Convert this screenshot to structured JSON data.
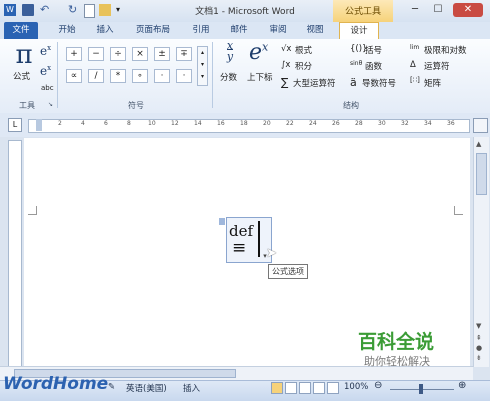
{
  "window": {
    "title": "文档1 - Microsoft Word",
    "context_tab_group": "公式工具",
    "minimize": "─",
    "maximize": "☐",
    "close": "✕"
  },
  "quick_access": {
    "icons": [
      "word-logo-icon",
      "save-icon",
      "undo-icon",
      "redo-icon",
      "new-document-icon",
      "open-folder-icon",
      "customize-icon"
    ]
  },
  "tabs": [
    "文件",
    "开始",
    "插入",
    "页面布局",
    "引用",
    "邮件",
    "审阅",
    "视图",
    "设计"
  ],
  "ribbon": {
    "tools": {
      "equation_label": "公式",
      "group_label": "工具"
    },
    "symbols": {
      "row1": [
        "+",
        "−",
        "÷",
        "×",
        "±",
        "∓"
      ],
      "row2": [
        "∝",
        "/",
        "*",
        "∘",
        "·",
        "⋅"
      ],
      "group_label": "符号"
    },
    "structures": {
      "fraction": "分数",
      "script": "上下标",
      "radical": "根式",
      "integral": "积分",
      "large_operator": "大型运算符",
      "bracket": "括号",
      "function": "函数",
      "accent": "导数符号",
      "limit_log": "极限和对数",
      "operator": "运算符",
      "matrix": "矩阵",
      "group_label": "结构"
    }
  },
  "document": {
    "equation_text": "def",
    "equation_symbol": "≡",
    "tooltip": "公式选项"
  },
  "status_bar": {
    "language": "英语(美国)",
    "insert_mode": "插入",
    "zoom": "100%"
  },
  "watermark": {
    "brand": "百科全说",
    "slogan": "助你轻松解决",
    "site": "WordHome"
  },
  "colors": {
    "file_tab": "#2a63b3",
    "context_tab": "#f6d27a",
    "brand_green": "#3b9c36"
  }
}
